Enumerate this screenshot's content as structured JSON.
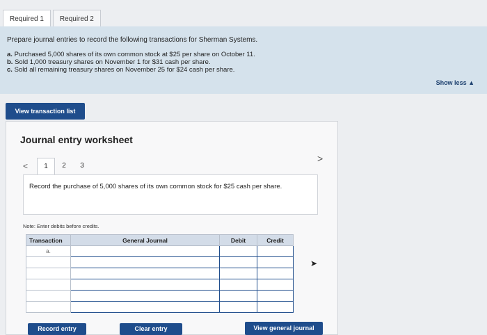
{
  "tabs": [
    {
      "label": "Required 1"
    },
    {
      "label": "Required 2"
    }
  ],
  "instructions": {
    "prompt": "Prepare journal entries to record the following transactions for Sherman Systems.",
    "items": [
      {
        "letter": "a.",
        "text": "Purchased 5,000 shares of its own common stock at $25 per share on October 11."
      },
      {
        "letter": "b.",
        "text": "Sold 1,000 treasury shares on November 1 for $31 cash per share."
      },
      {
        "letter": "c.",
        "text": "Sold all remaining treasury shares on November 25 for $24 cash per share."
      }
    ],
    "show_less": "Show less ▲"
  },
  "view_transaction_list": "View transaction list",
  "worksheet": {
    "title": "Journal entry worksheet",
    "prev_arrow": "<",
    "next_arrow": ">",
    "pages": [
      "1",
      "2",
      "3"
    ],
    "record_text": "Record the purchase of 5,000 shares of its own common stock for $25 cash per share.",
    "note": "Note: Enter debits before credits.",
    "table": {
      "headers": {
        "transaction": "Transaction",
        "general_journal": "General Journal",
        "debit": "Debit",
        "credit": "Credit"
      },
      "rows": [
        {
          "transaction": "a."
        },
        {
          "transaction": ""
        },
        {
          "transaction": ""
        },
        {
          "transaction": ""
        },
        {
          "transaction": ""
        },
        {
          "transaction": ""
        }
      ]
    },
    "buttons": {
      "record_entry": "Record entry",
      "clear_entry": "Clear entry",
      "view_general_journal": "View general journal"
    }
  }
}
